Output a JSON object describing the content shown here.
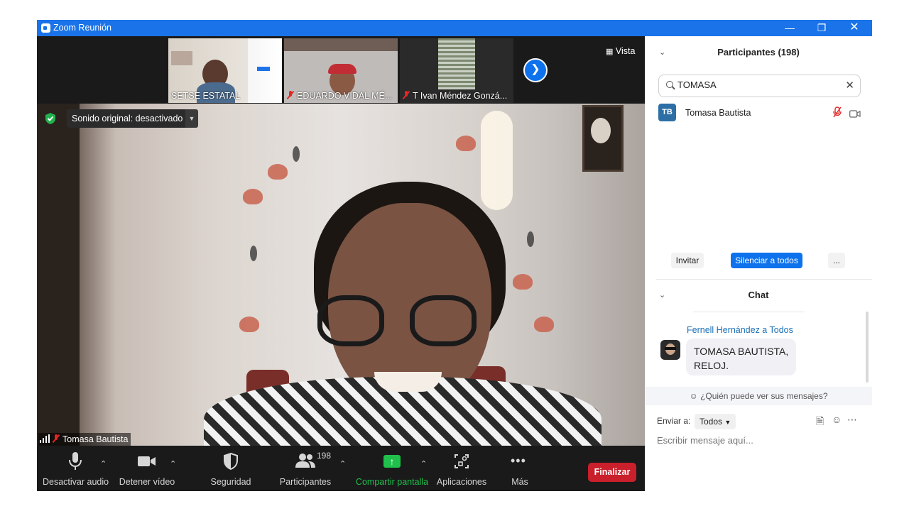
{
  "window": {
    "title": "Zoom Reunión"
  },
  "thumbnails": [
    {
      "name": "SETSE ESTATAL",
      "muted": false
    },
    {
      "name": "EDUARDO VIDAL MÉ...",
      "muted": true
    },
    {
      "name": "T Ivan Méndez Gonzá...",
      "muted": true
    }
  ],
  "view": {
    "label": "Vista"
  },
  "sound": {
    "label": "Sonido original: desactivado"
  },
  "speaker": {
    "name": "Tomasa Bautista"
  },
  "toolbar": {
    "audio": "Desactivar audio",
    "video": "Detener vídeo",
    "security": "Seguridad",
    "participants": "Participantes",
    "participants_count": "198",
    "share": "Compartir pantalla",
    "apps": "Aplicaciones",
    "more": "Más",
    "end": "Finalizar"
  },
  "participants_panel": {
    "title": "Participantes (198)",
    "search_value": "TOMASA",
    "results": [
      {
        "initials": "TB",
        "name": "Tomasa Bautista"
      }
    ],
    "invite": "Invitar",
    "mute_all": "Silenciar a todos",
    "more": "..."
  },
  "chat": {
    "title": "Chat",
    "messages": [
      {
        "sender": "Fernell Hernández a Todos",
        "text": "TOMASA BAUTISTA, RELOJ."
      }
    ],
    "who_can_see": "¿Quién puede ver sus mensajes?",
    "send_to_label": "Enviar a:",
    "send_to_value": "Todos",
    "placeholder": "Escribir mensaje aquí..."
  },
  "colors": {
    "accent": "#0e72ed",
    "titlebar": "#1a73e8",
    "end_button": "#c9202b",
    "share_green": "#20c04d"
  }
}
